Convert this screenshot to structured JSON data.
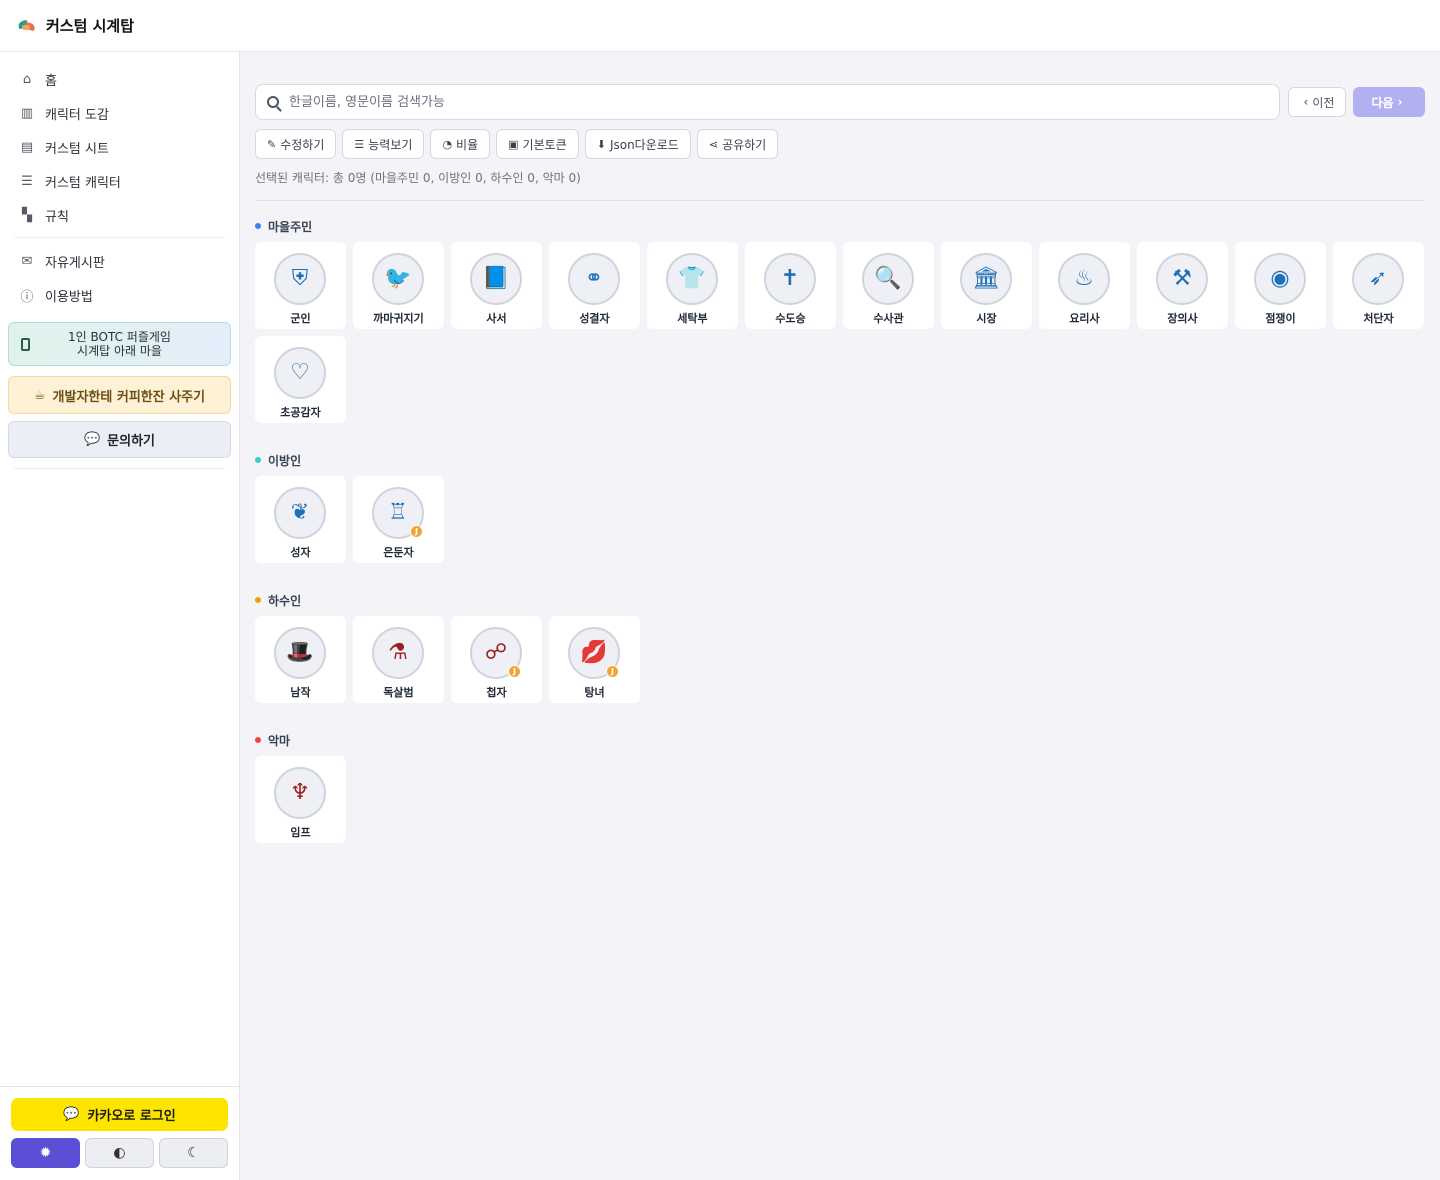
{
  "app": {
    "title": "커스텀 시계탑"
  },
  "sidebar": {
    "items": [
      {
        "label": "홈",
        "icon": "home-icon",
        "glyph": "⌂"
      },
      {
        "label": "캐릭터 도감",
        "icon": "book-icon",
        "glyph": "▥"
      },
      {
        "label": "커스텀 시트",
        "icon": "file-icon",
        "glyph": "▤"
      },
      {
        "label": "커스텀 캐릭터",
        "icon": "list-icon",
        "glyph": "☰"
      },
      {
        "label": "규칙",
        "icon": "scroll-icon",
        "glyph": "▚"
      }
    ],
    "items2": [
      {
        "label": "자유게시판",
        "icon": "comments-icon",
        "glyph": "✉"
      },
      {
        "label": "이용방법",
        "icon": "info-icon",
        "glyph": "ⓘ"
      }
    ],
    "promo_line1": "1인 BOTC 퍼즐게임",
    "promo_line2": "시계탑 아래 마을",
    "coffee_label": "개발자한테 커피한잔 사주기",
    "ask_label": "문의하기",
    "kakao_label": "카카오로 로그인",
    "themes": [
      {
        "name": "light",
        "glyph": "✹",
        "active": true
      },
      {
        "name": "auto",
        "glyph": "◐",
        "active": false
      },
      {
        "name": "dark",
        "glyph": "☾",
        "active": false
      }
    ]
  },
  "search": {
    "placeholder": "한글이름, 영문이름 검색가능",
    "value": ""
  },
  "nav_buttons": {
    "prev": "이전",
    "next": "다음"
  },
  "toolbar": [
    {
      "label": "수정하기",
      "icon": "edit-icon",
      "glyph": "✎"
    },
    {
      "label": "능력보기",
      "icon": "list-icon",
      "glyph": "☰"
    },
    {
      "label": "비율",
      "icon": "pie-chart-icon",
      "glyph": "◔"
    },
    {
      "label": "기본토큰",
      "icon": "image-icon",
      "glyph": "▣"
    },
    {
      "label": "Json다운로드",
      "icon": "file-download-icon",
      "glyph": "⬇"
    },
    {
      "label": "공유하기",
      "icon": "share-icon",
      "glyph": "⋖"
    }
  ],
  "selected_info": "선택된 캐릭터: 총 0명 (마을주민 0, 이방인 0, 하수인 0, 악마 0)",
  "colors": {
    "townsfolk": "#3b82f6",
    "outsider": "#2dd4bf",
    "minion": "#f59e0b",
    "demon": "#ef4444",
    "accent": "#5b4fd6"
  },
  "sections": [
    {
      "title": "마을주민",
      "kind": "good",
      "dot": "#3b82f6",
      "characters": [
        {
          "name": "군인",
          "icon": "shield-icon",
          "glyph": "⛨",
          "jinx": false
        },
        {
          "name": "까마귀지기",
          "icon": "raven-icon",
          "glyph": "🐦",
          "jinx": false
        },
        {
          "name": "사서",
          "icon": "book-icon",
          "glyph": "📘",
          "jinx": false
        },
        {
          "name": "성결자",
          "icon": "rings-icon",
          "glyph": "⚭",
          "jinx": false
        },
        {
          "name": "세탁부",
          "icon": "laundry-icon",
          "glyph": "👕",
          "jinx": false
        },
        {
          "name": "수도승",
          "icon": "cross-icon",
          "glyph": "✝",
          "jinx": false
        },
        {
          "name": "수사관",
          "icon": "magnifier-icon",
          "glyph": "🔍",
          "jinx": false
        },
        {
          "name": "시장",
          "icon": "town-hall-icon",
          "glyph": "🏛",
          "jinx": false
        },
        {
          "name": "요리사",
          "icon": "chef-hat-icon",
          "glyph": "♨",
          "jinx": false
        },
        {
          "name": "장의사",
          "icon": "shovel-icon",
          "glyph": "⚒",
          "jinx": false
        },
        {
          "name": "점쟁이",
          "icon": "crystal-ball-icon",
          "glyph": "◉",
          "jinx": false
        },
        {
          "name": "처단자",
          "icon": "bow-icon",
          "glyph": "➶",
          "jinx": false
        },
        {
          "name": "초공감자",
          "icon": "heart-icon",
          "glyph": "♡",
          "jinx": false
        }
      ]
    },
    {
      "title": "이방인",
      "kind": "good",
      "dot": "#2dd4bf",
      "characters": [
        {
          "name": "성자",
          "icon": "wings-icon",
          "glyph": "❦",
          "jinx": false
        },
        {
          "name": "은둔자",
          "icon": "lantern-icon",
          "glyph": "♖",
          "jinx": true
        }
      ]
    },
    {
      "title": "하수인",
      "kind": "evil",
      "dot": "#f59e0b",
      "characters": [
        {
          "name": "남작",
          "icon": "top-hat-icon",
          "glyph": "🎩",
          "jinx": false
        },
        {
          "name": "독살범",
          "icon": "vial-icon",
          "glyph": "⚗",
          "jinx": false
        },
        {
          "name": "첩자",
          "icon": "spy-icon",
          "glyph": "☍",
          "jinx": true
        },
        {
          "name": "탕녀",
          "icon": "lips-icon",
          "glyph": "💋",
          "jinx": true
        }
      ]
    },
    {
      "title": "악마",
      "kind": "evil",
      "dot": "#ef4444",
      "characters": [
        {
          "name": "임프",
          "icon": "trident-icon",
          "glyph": "♆",
          "jinx": false
        }
      ]
    }
  ],
  "jinx_mark": "J"
}
